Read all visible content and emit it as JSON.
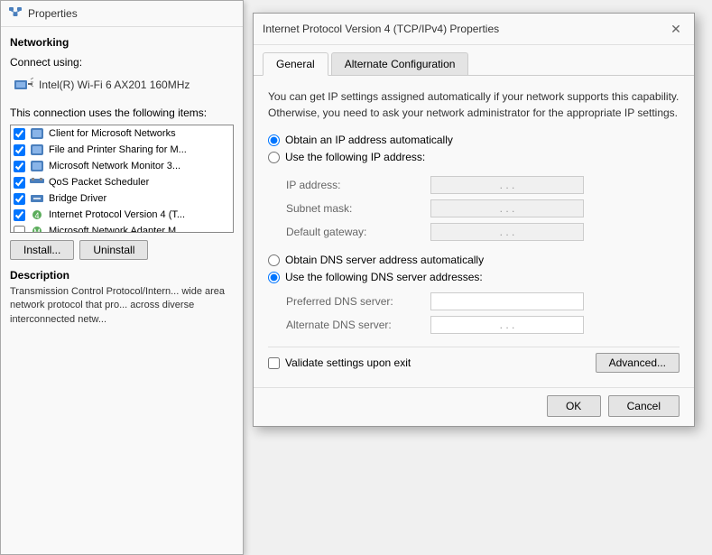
{
  "bgWindow": {
    "title": "Properties",
    "networkingLabel": "Networking",
    "connectUsingLabel": "Connect using:",
    "adapterName": "Intel(R) Wi-Fi 6 AX201 160MHz",
    "connectionItemsLabel": "This connection uses the following items:",
    "items": [
      {
        "checked": true,
        "label": "Client for Microsoft Networks"
      },
      {
        "checked": true,
        "label": "File and Printer Sharing for M..."
      },
      {
        "checked": true,
        "label": "Microsoft Network Monitor 3..."
      },
      {
        "checked": true,
        "label": "QoS Packet Scheduler"
      },
      {
        "checked": true,
        "label": "Bridge Driver"
      },
      {
        "checked": true,
        "label": "Internet Protocol Version 4 (T..."
      },
      {
        "checked": false,
        "label": "Microsoft Network Adapter M..."
      }
    ],
    "installBtn": "Install...",
    "uninstallBtn": "Uninstall",
    "descTitle": "Description",
    "descText": "Transmission Control Protocol/Intern... wide area network protocol that pro... across diverse interconnected netw..."
  },
  "dialog": {
    "title": "Internet Protocol Version 4 (TCP/IPv4) Properties",
    "tabs": [
      {
        "label": "General",
        "active": true
      },
      {
        "label": "Alternate Configuration",
        "active": false
      }
    ],
    "infoText": "You can get IP settings assigned automatically if your network supports this capability. Otherwise, you need to ask your network administrator for the appropriate IP settings.",
    "obtainIPAuto": "Obtain an IP address automatically",
    "useFollowingIP": "Use the following IP address:",
    "ipAddressLabel": "IP address:",
    "subnetMaskLabel": "Subnet mask:",
    "defaultGatewayLabel": "Default gateway:",
    "ipAddressValue": ". . .",
    "subnetMaskValue": ". . .",
    "defaultGatewayValue": ". . .",
    "obtainDNSAuto": "Obtain DNS server address automatically",
    "useFollowingDNS": "Use the following DNS server addresses:",
    "preferredDNSLabel": "Preferred DNS server:",
    "alternateDNSLabel": "Alternate DNS server:",
    "preferredDNSValue": "",
    "alternateDNSValue": ". . .",
    "validateLabel": "Validate settings upon exit",
    "advancedBtn": "Advanced...",
    "okBtn": "OK",
    "cancelBtn": "Cancel"
  }
}
